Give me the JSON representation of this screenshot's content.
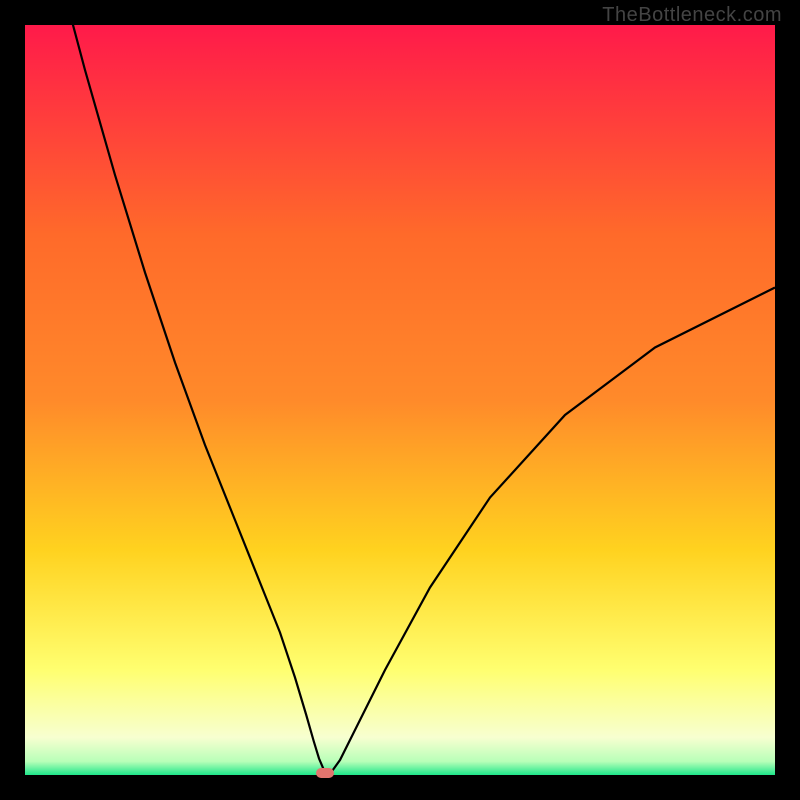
{
  "watermark": "TheBottleneck.com",
  "chart_data": {
    "type": "line",
    "title": "",
    "xlabel": "",
    "ylabel": "",
    "xlim": [
      0,
      100
    ],
    "ylim": [
      0,
      100
    ],
    "grid": false,
    "legend": false,
    "gradient_colors": {
      "top": "#ff1a4a",
      "mid_upper": "#ff8a2a",
      "mid": "#ffd21f",
      "mid_lower": "#ffff70",
      "near_bottom": "#f7ffd0",
      "bottom": "#1ee68a"
    },
    "series": [
      {
        "name": "bottleneck-curve",
        "color": "#000000",
        "x": [
          0,
          4,
          8,
          12,
          16,
          20,
          24,
          28,
          32,
          34,
          36,
          37.5,
          38.5,
          39.2,
          39.8,
          40.2,
          41,
          42,
          44,
          48,
          54,
          62,
          72,
          84,
          98,
          100
        ],
        "y": [
          125,
          109,
          94,
          80,
          67,
          55,
          44,
          34,
          24,
          19,
          13,
          8,
          4.5,
          2.2,
          0.8,
          0.3,
          0.6,
          2,
          6,
          14,
          25,
          37,
          48,
          57,
          64,
          65
        ]
      }
    ],
    "marker": {
      "name": "optimal-point",
      "x": 40,
      "y": 0,
      "color": "#e2746e"
    },
    "background_band": {
      "green_start_y": 0,
      "green_end_y": 1.5
    }
  }
}
